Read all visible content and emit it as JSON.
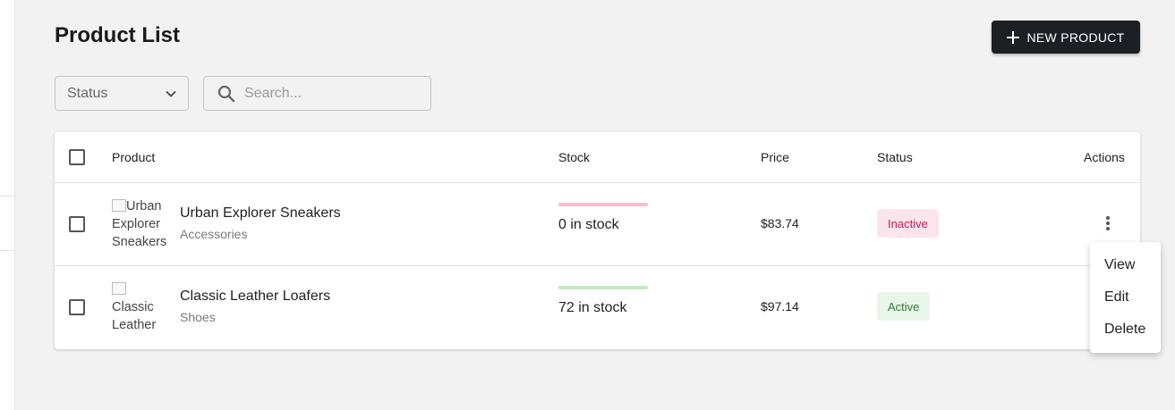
{
  "header": {
    "title": "Product List",
    "new_product_label": "NEW PRODUCT"
  },
  "filters": {
    "status_label": "Status",
    "search_placeholder": "Search..."
  },
  "table": {
    "columns": [
      "Product",
      "Stock",
      "Price",
      "Status",
      "Actions"
    ],
    "rows": [
      {
        "image_alt": "Urban Explorer Sneakers",
        "image_alt_lines": [
          "Urban",
          "Explorer",
          "Sneakers"
        ],
        "name": "Urban Explorer Sneakers",
        "category": "Accessories",
        "stock": 0,
        "stock_text": "0 in stock",
        "price": "$83.74",
        "status": "Inactive"
      },
      {
        "image_alt": "Classic Leather Loafers",
        "image_alt_lines": [
          "Classic",
          "Leather"
        ],
        "name": "Classic Leather Loafers",
        "category": "Shoes",
        "stock": 72,
        "stock_text": "72 in stock",
        "price": "$97.14",
        "status": "Active"
      }
    ]
  },
  "action_menu": {
    "items": [
      "View",
      "Edit",
      "Delete"
    ]
  },
  "icons": {
    "new_product": "plus-icon",
    "status_select": "chevron-down-icon",
    "search": "search-icon",
    "row_actions": "more-vertical-icon"
  },
  "colors": {
    "primary_button": "#1c2025",
    "inactive_badge_bg": "#fce4ec",
    "inactive_badge_text": "#c2185b",
    "active_badge_bg": "#e8f5e9",
    "active_badge_text": "#2e7d32",
    "stock_empty_bar": "#f8bbd0",
    "stock_ok_bar": "#c8e6c9"
  }
}
